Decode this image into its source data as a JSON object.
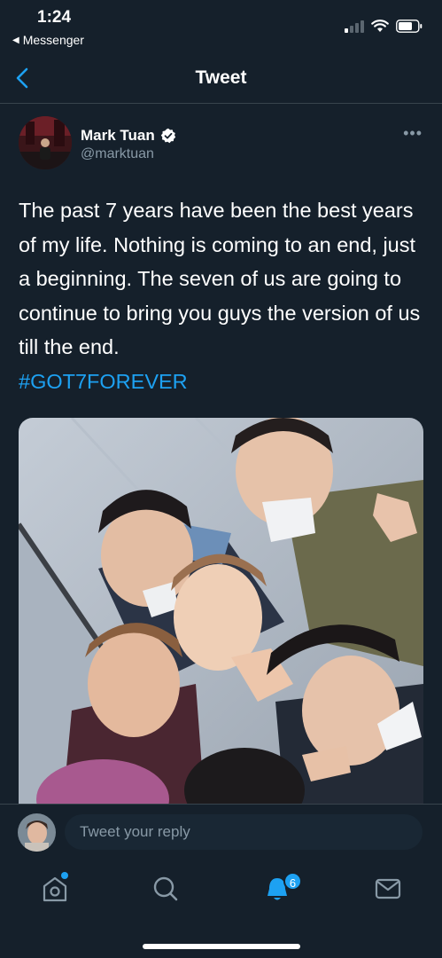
{
  "status_bar": {
    "time": "1:24",
    "back_app": "Messenger"
  },
  "header": {
    "title": "Tweet"
  },
  "tweet": {
    "author_name": "Mark Tuan",
    "author_handle": "@marktuan",
    "verified": true,
    "text": "The past 7 years have been the best years of my life. Nothing is coming to an end, just a beginning. The seven of us are going to continue to bring you guys the version of us till the end.",
    "hashtag": "#GOT7FOREVER"
  },
  "reply": {
    "placeholder": "Tweet your reply"
  },
  "tabbar": {
    "tabs": [
      {
        "name": "home",
        "icon": "home-icon"
      },
      {
        "name": "search",
        "icon": "search-icon"
      },
      {
        "name": "notifications",
        "icon": "bell-icon"
      },
      {
        "name": "messages",
        "icon": "mail-icon"
      }
    ],
    "notification_count": "6"
  },
  "colors": {
    "background": "#15202b",
    "accent": "#1da1f2",
    "secondary_text": "#8899a6",
    "divider": "#38444d"
  }
}
